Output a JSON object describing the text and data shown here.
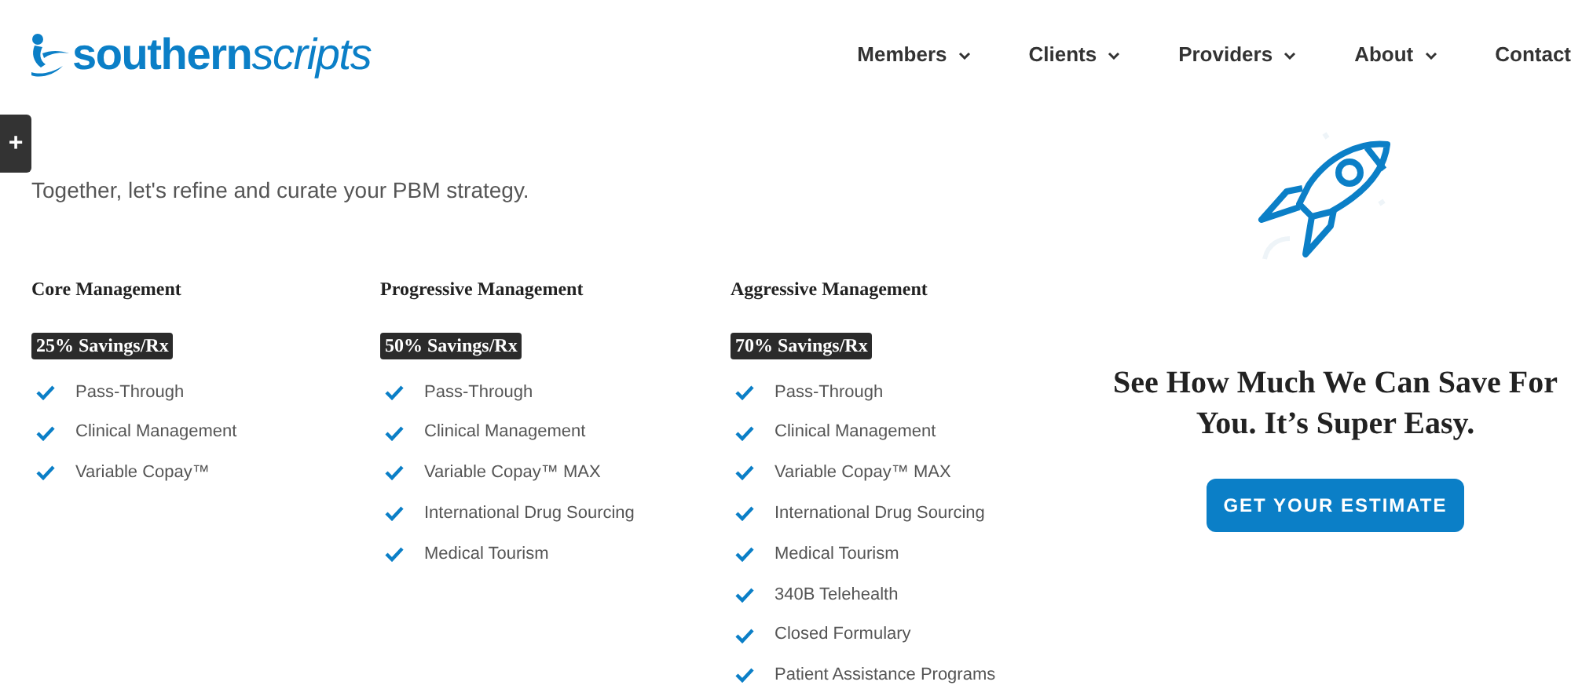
{
  "logo": {
    "bold": "southern",
    "light": "scripts"
  },
  "nav": [
    {
      "label": "Members",
      "dropdown": true
    },
    {
      "label": "Clients",
      "dropdown": true
    },
    {
      "label": "Providers",
      "dropdown": true
    },
    {
      "label": "About",
      "dropdown": true
    },
    {
      "label": "Contact",
      "dropdown": false
    }
  ],
  "side_tab": {
    "label": "+"
  },
  "tagline": "Together, let's refine and curate your PBM strategy.",
  "plans": [
    {
      "title": "Core Management",
      "badge": "25% Savings/Rx",
      "features": [
        "Pass-Through",
        "Clinical Management",
        "Variable Copay™"
      ]
    },
    {
      "title": "Progressive Management",
      "badge": "50% Savings/Rx",
      "features": [
        "Pass-Through",
        "Clinical Management",
        "Variable Copay™ MAX",
        "International Drug Sourcing",
        "Medical Tourism"
      ]
    },
    {
      "title": "Aggressive Management",
      "badge": "70% Savings/Rx",
      "features": [
        "Pass-Through",
        "Clinical Management",
        "Variable Copay™ MAX",
        "International Drug Sourcing",
        "Medical Tourism",
        "340B Telehealth",
        "Closed Formulary",
        "Patient Assistance Programs"
      ]
    }
  ],
  "promo": {
    "heading": "See How Much We Can Save For You. It’s Super Easy.",
    "button": "GET YOUR ESTIMATE"
  }
}
